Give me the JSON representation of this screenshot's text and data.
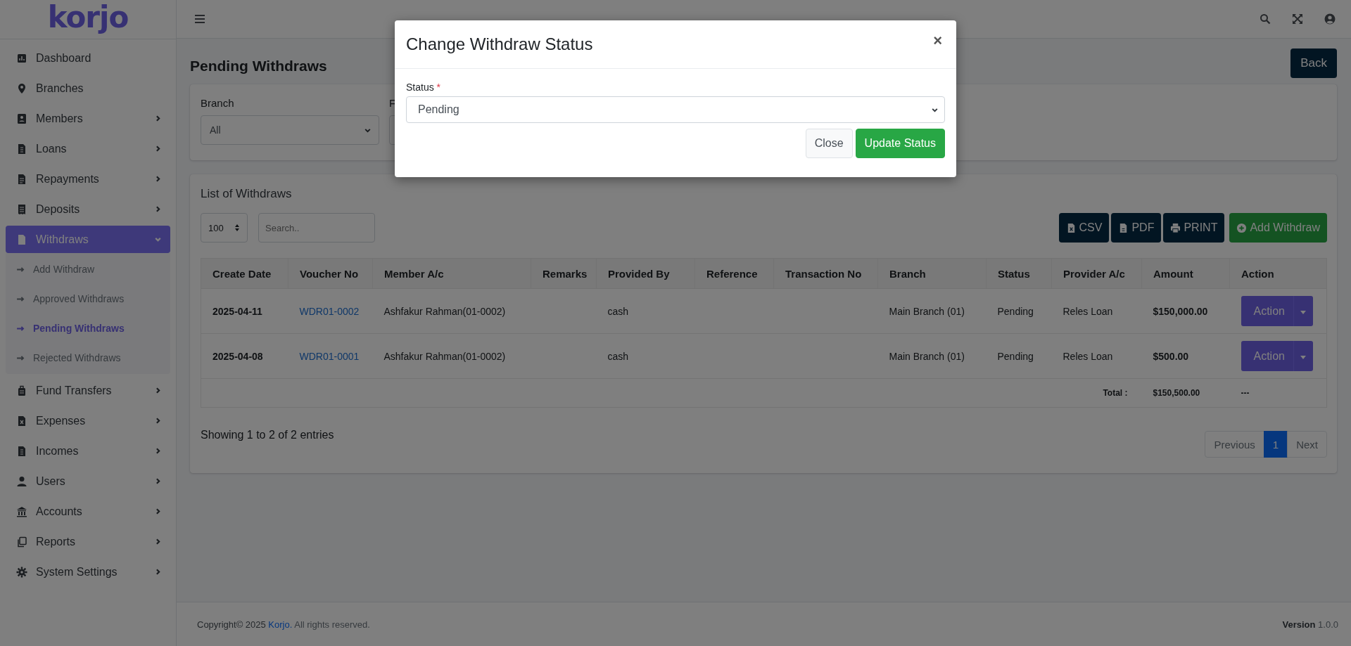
{
  "brand": {
    "logo": "korjo"
  },
  "sidebar": {
    "items": [
      {
        "label": "Dashboard",
        "selected": false
      },
      {
        "label": "Branches",
        "selected": false
      },
      {
        "label": "Members",
        "expanded": false,
        "selected": false
      },
      {
        "label": "Loans",
        "expanded": false,
        "selected": false
      },
      {
        "label": "Repayments",
        "expanded": false,
        "selected": false
      },
      {
        "label": "Deposits",
        "expanded": false,
        "selected": false
      },
      {
        "label": "Withdraws",
        "expanded": true,
        "selected": true,
        "children": [
          {
            "label": "Add Withdraw",
            "selected": false
          },
          {
            "label": "Approved Withdraws",
            "selected": false
          },
          {
            "label": "Pending Withdraws",
            "selected": true
          },
          {
            "label": "Rejected Withdraws",
            "selected": false
          }
        ]
      },
      {
        "label": "Fund Transfers",
        "expanded": false,
        "selected": false
      },
      {
        "label": "Expenses",
        "expanded": false,
        "selected": false
      },
      {
        "label": "Incomes",
        "expanded": false,
        "selected": false
      },
      {
        "label": "Users",
        "expanded": false,
        "selected": false
      },
      {
        "label": "Accounts",
        "expanded": false,
        "selected": false
      },
      {
        "label": "Reports",
        "expanded": false,
        "selected": false
      },
      {
        "label": "System Settings",
        "expanded": false,
        "selected": false
      }
    ]
  },
  "page": {
    "title": "Pending Withdraws",
    "back_button": "Back"
  },
  "filters": [
    {
      "label": "Branch",
      "value": "All"
    },
    {
      "label": "F"
    }
  ],
  "list": {
    "title": "List of Withdraws",
    "page_size": "100",
    "search_placeholder": "Search..",
    "buttons": [
      {
        "label": "CSV",
        "kind": "csv"
      },
      {
        "label": "PDF",
        "kind": "pdf"
      },
      {
        "label": "PRINT",
        "kind": "print"
      },
      {
        "label": "Add Withdraw",
        "kind": "add"
      }
    ]
  },
  "table": {
    "columns": [
      "Create Date",
      "Voucher No",
      "Member A/c",
      "Remarks",
      "Provided By",
      "Reference",
      "Transaction No",
      "Branch",
      "Status",
      "Provider A/c",
      "Amount",
      "Action"
    ],
    "rows": [
      {
        "create_date": "2025-04-11",
        "voucher_no": "WDR01-0002",
        "member": "Ashfakur Rahman(01-0002)",
        "provided_by": "cash",
        "branch": "Main Branch (01)",
        "status": "Pending",
        "provider_account": "Reles Loan",
        "amount": "$150,000.00",
        "action": "Action"
      },
      {
        "create_date": "2025-04-08",
        "voucher_no": "WDR01-0001",
        "member": "Ashfakur Rahman(01-0002)",
        "provided_by": "cash",
        "branch": "Main Branch (01)",
        "status": "Pending",
        "provider_account": "Reles Loan",
        "amount": "$500.00",
        "action": "Action"
      }
    ],
    "total": {
      "label": "Total :",
      "amount": "$150,500.00",
      "action": "---"
    }
  },
  "summary": "Showing 1 to 2 of 2 entries",
  "pagination": [
    {
      "label": "Previous",
      "selected": false
    },
    {
      "label": "1",
      "selected": true
    },
    {
      "label": "Next",
      "selected": false
    }
  ],
  "footer": {
    "copyright": "Copyright© 2025",
    "link": "Korjo.",
    "rights": "All rights reserved.",
    "version": "**Version** 1.0.0"
  },
  "modal": {
    "title": "Change Withdraw Status",
    "close": "×",
    "label": "Status",
    "required_mark": "*",
    "value": "Pending",
    "buttons": [
      {
        "label": "Close",
        "kind": "secondary"
      },
      {
        "label": "Update Status",
        "kind": "primary"
      }
    ]
  }
}
